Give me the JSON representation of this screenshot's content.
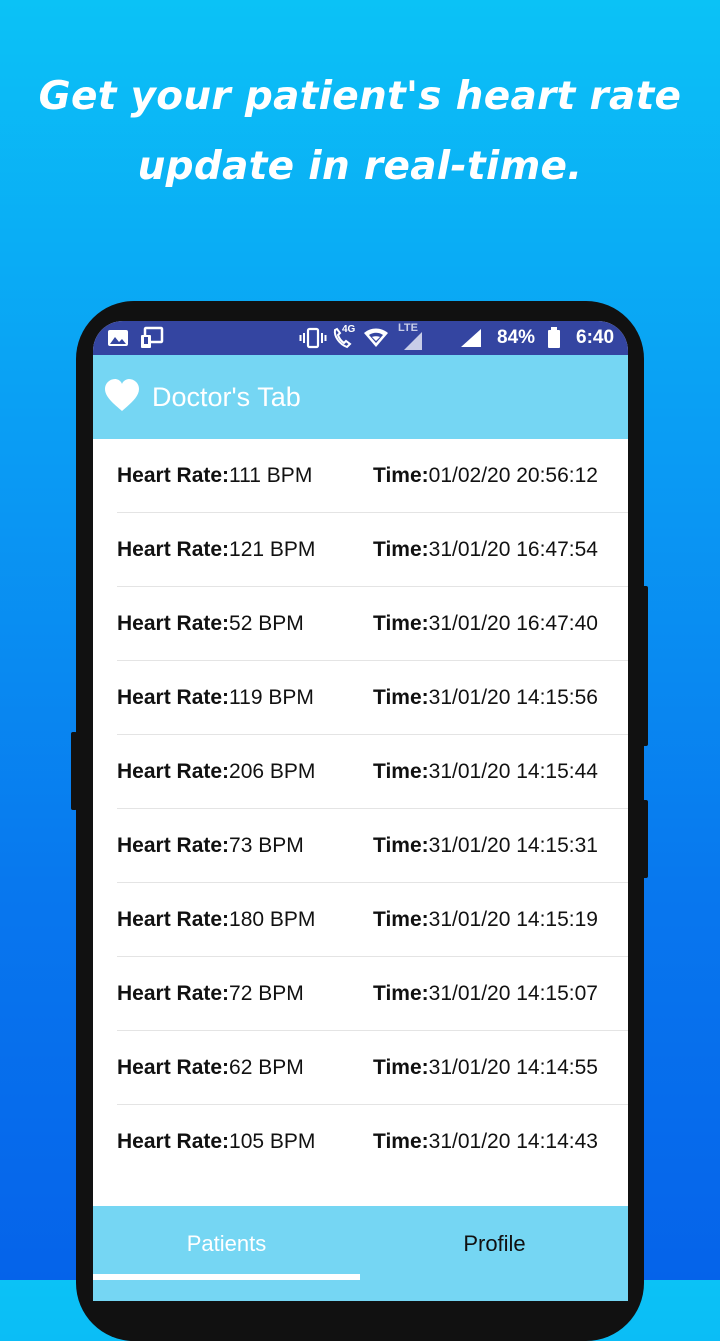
{
  "headline": {
    "line1": "Get your patient's heart rate",
    "line2": "update in real-time."
  },
  "status_bar": {
    "left_icons": [
      "image-icon",
      "screen-cast-icon"
    ],
    "right_icons": [
      "vibrate-icon",
      "volte-call-icon",
      "wifi-icon",
      "lte-signal-icon",
      "signal-icon",
      "battery-icon"
    ],
    "network_4g": "4G",
    "network_lte": "LTE",
    "battery": "84%",
    "time": "6:40"
  },
  "app_bar": {
    "icon": "heart-icon",
    "title": "Doctor's Tab"
  },
  "readings": {
    "heart_rate_label": "Heart Rate:",
    "time_label": "Time:",
    "items": [
      {
        "rate": "111 BPM",
        "time": "01/02/20 20:56:12"
      },
      {
        "rate": "121 BPM",
        "time": "31/01/20 16:47:54"
      },
      {
        "rate": "52 BPM",
        "time": "31/01/20 16:47:40"
      },
      {
        "rate": "119 BPM",
        "time": "31/01/20 14:15:56"
      },
      {
        "rate": "206 BPM",
        "time": "31/01/20 14:15:44"
      },
      {
        "rate": "73 BPM",
        "time": "31/01/20 14:15:31"
      },
      {
        "rate": "180 BPM",
        "time": "31/01/20 14:15:19"
      },
      {
        "rate": "72 BPM",
        "time": "31/01/20 14:15:07"
      },
      {
        "rate": "62 BPM",
        "time": "31/01/20 14:14:55"
      },
      {
        "rate": "105 BPM",
        "time": "31/01/20 14:14:43"
      }
    ]
  },
  "bottom_nav": {
    "tabs": [
      {
        "label": "Patients",
        "selected": true
      },
      {
        "label": "Profile",
        "selected": false
      }
    ]
  },
  "colors": {
    "app_bar": "#75d6f3",
    "status_bar": "#3445a1",
    "background_top": "#0bc2f6",
    "background_bottom": "#0563ea"
  }
}
